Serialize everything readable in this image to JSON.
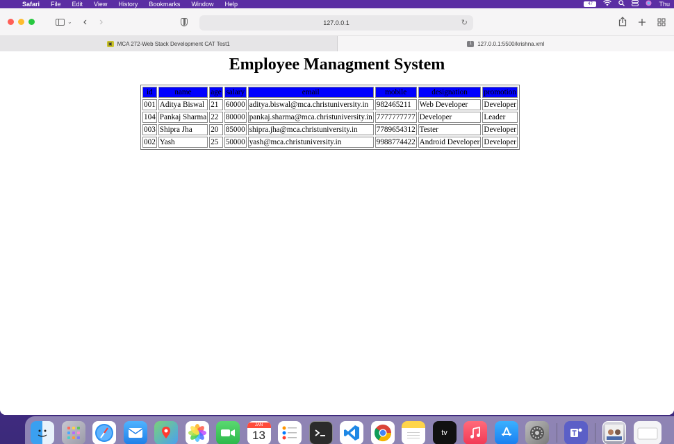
{
  "menubar": {
    "app_name": "Safari",
    "items": [
      "File",
      "Edit",
      "View",
      "History",
      "Bookmarks",
      "Window",
      "Help"
    ],
    "battery": "47",
    "clock": "Thu"
  },
  "toolbar": {
    "url": "127.0.0.1"
  },
  "tabs": [
    {
      "title": "MCA 272-Web Stack Development CAT Test1",
      "favicon": "yellow-favicon-icon",
      "active": false
    },
    {
      "title": "127.0.0.1:5500/krishna.xml",
      "favicon": "gray-favicon-icon",
      "favicon_text": "1",
      "active": true
    }
  ],
  "page": {
    "title": "Employee Managment System",
    "headers": [
      "id",
      "name",
      "age",
      "salary",
      "email",
      "mobile",
      "designation",
      "promotion"
    ],
    "rows": [
      [
        "001",
        "Aditya Biswal",
        "21",
        "60000",
        "aditya.biswal@mca.christuniversity.in",
        "982465211",
        "Web Developer",
        "Developer"
      ],
      [
        "104",
        "Pankaj Sharma",
        "22",
        "80000",
        "pankaj.sharma@mca.christuniversity.in",
        "7777777777",
        "Developer",
        "Leader"
      ],
      [
        "003",
        "Shipra Jha",
        "20",
        "85000",
        "shipra.jha@mca.christuniversity.in",
        "7789654312",
        "Tester",
        "Developer"
      ],
      [
        "002",
        "Yash",
        "25",
        "50000",
        "yash@mca.christuniversity.in",
        "9988774422",
        "Android Developer",
        "Developer"
      ]
    ]
  },
  "dock": {
    "calendar_month": "JAN",
    "calendar_day": "13",
    "tv_label": "tv"
  },
  "colors": {
    "table_header_bg": "#0000ff"
  }
}
